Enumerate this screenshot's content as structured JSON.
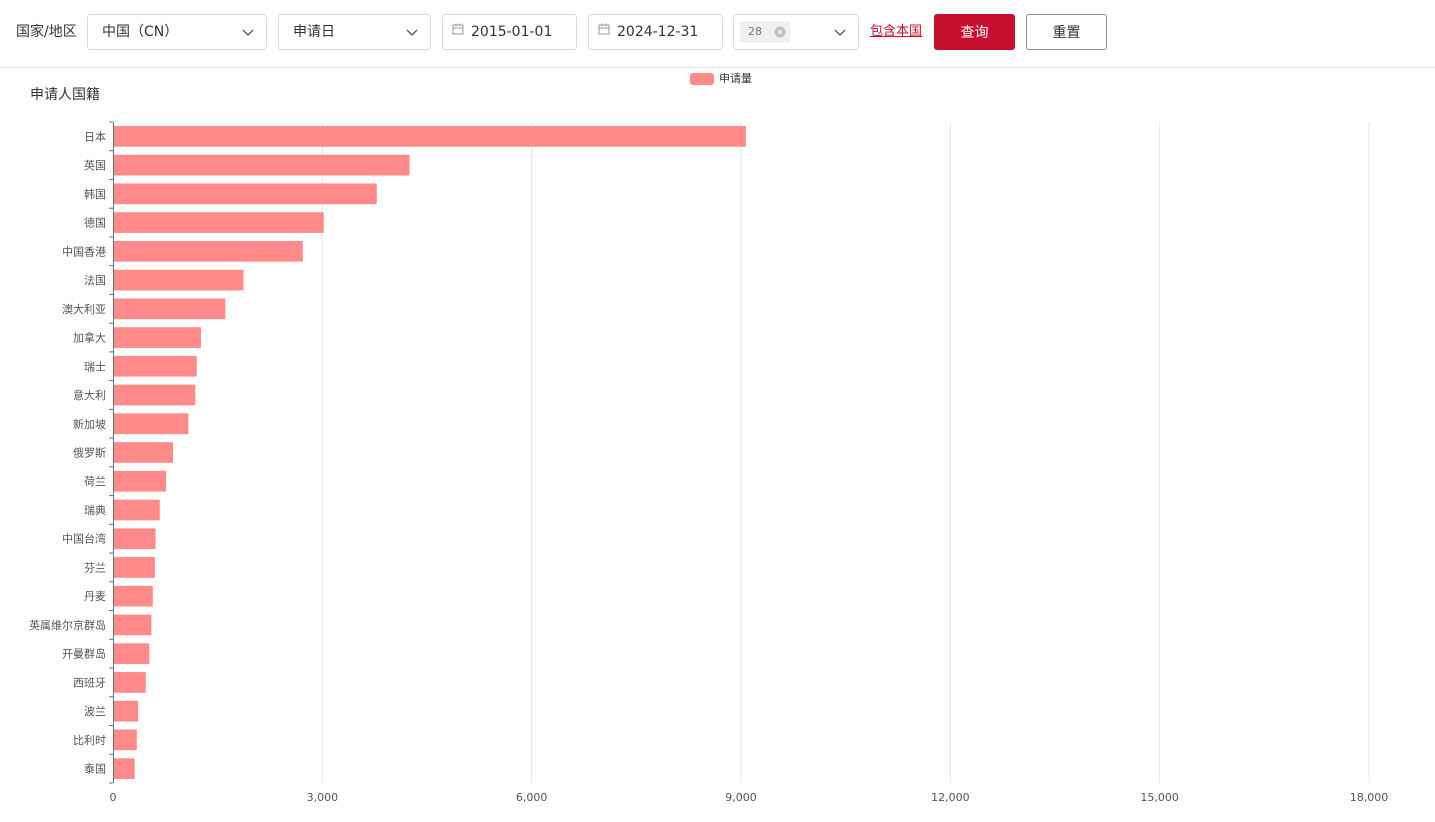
{
  "filters": {
    "label": "国家/地区",
    "country_select": "中国（CN）",
    "date_type_select": "申请日",
    "start_date": "2015-01-01",
    "end_date": "2024-12-31",
    "multi_select_tag": "28",
    "include_home_link": "包含本国",
    "query_button": "查询",
    "reset_button": "重置"
  },
  "colors": {
    "accent": "#c8102e",
    "bar": "#ff8a8a"
  },
  "icons": {
    "dropdown": "chevron-down-icon",
    "date": "calendar-icon",
    "tag_close": "close-circle-icon"
  },
  "chart_data": {
    "type": "bar",
    "orientation": "horizontal",
    "title": "申请人国籍",
    "legend": "申请量",
    "legend_position": "top-center",
    "categories": [
      "日本",
      "英国",
      "韩国",
      "德国",
      "中国香港",
      "法国",
      "澳大利亚",
      "加拿大",
      "瑞士",
      "意大利",
      "新加坡",
      "俄罗斯",
      "荷兰",
      "瑞典",
      "中国台湾",
      "芬兰",
      "丹麦",
      "英属维尔京群岛",
      "开曼群岛",
      "西班牙",
      "波兰",
      "比利时",
      "泰国"
    ],
    "values": [
      9070,
      4250,
      3780,
      3020,
      2720,
      1870,
      1610,
      1260,
      1200,
      1180,
      1080,
      860,
      760,
      670,
      610,
      600,
      570,
      550,
      520,
      470,
      360,
      340,
      310
    ],
    "xlim": [
      0,
      18000
    ],
    "xticks": [
      "0",
      "3,000",
      "6,000",
      "9,000",
      "12,000",
      "15,000",
      "18,000"
    ],
    "xtick_values": [
      0,
      3000,
      6000,
      9000,
      12000,
      15000,
      18000
    ],
    "grid": true
  }
}
